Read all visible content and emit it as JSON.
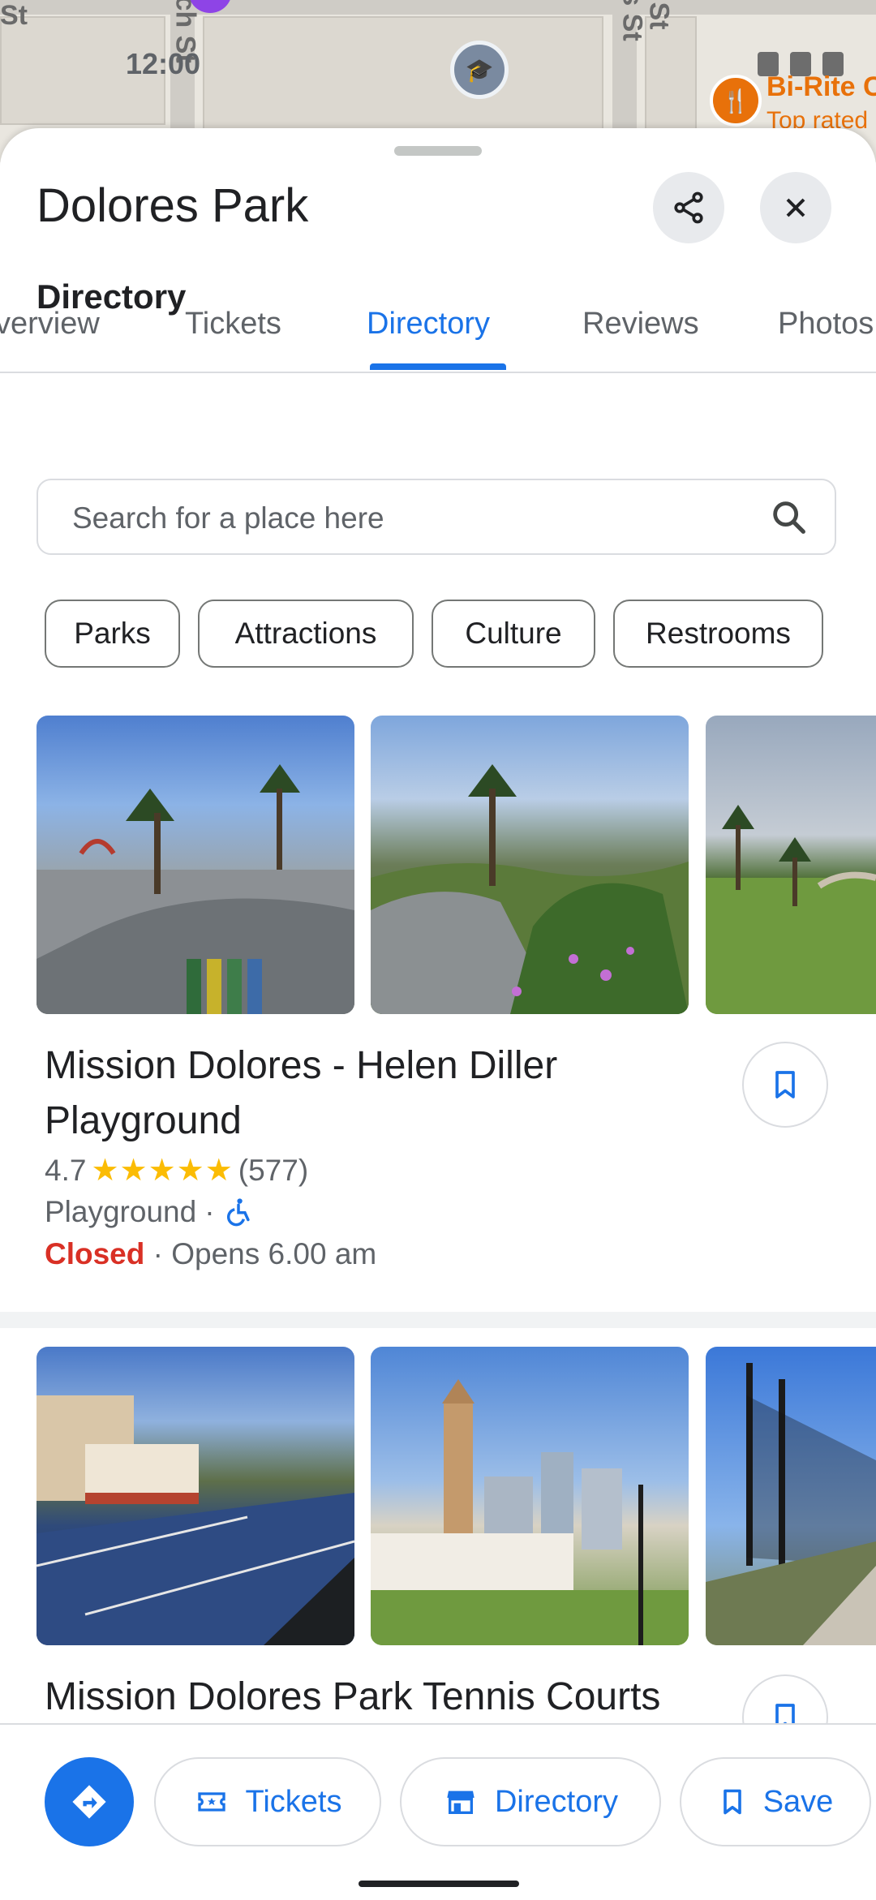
{
  "map": {
    "time": "12:00",
    "street_labels": [
      "St",
      "rch St",
      "s St",
      "St"
    ],
    "poi_name": "Bi-Rite C",
    "poi_sub": "Top rated"
  },
  "sheet": {
    "title": "Dolores Park",
    "share_icon": "share-icon",
    "close_icon": "close-icon"
  },
  "tabs": [
    {
      "label": "verview"
    },
    {
      "label": "Tickets"
    },
    {
      "label": "Directory"
    },
    {
      "label": "Reviews"
    },
    {
      "label": "Photos"
    }
  ],
  "directory": {
    "title": "Directory",
    "search_placeholder": "Search for a place here",
    "chips": [
      "Parks",
      "Attractions",
      "Culture",
      "Restrooms"
    ]
  },
  "places": [
    {
      "name": "Mission Dolores - Helen Diller Playground",
      "rating": "4.7",
      "stars": "★★★★★",
      "reviews": "(577)",
      "category": "Playground",
      "status": "Closed",
      "hours": "Opens 6.00 am"
    },
    {
      "name": "Mission Dolores Park Tennis Courts"
    }
  ],
  "actions": {
    "tickets": "Tickets",
    "directory": "Directory",
    "save": "Save"
  },
  "colors": {
    "accent": "#1a73e8",
    "closed": "#d93025",
    "star": "#fbbc04"
  }
}
